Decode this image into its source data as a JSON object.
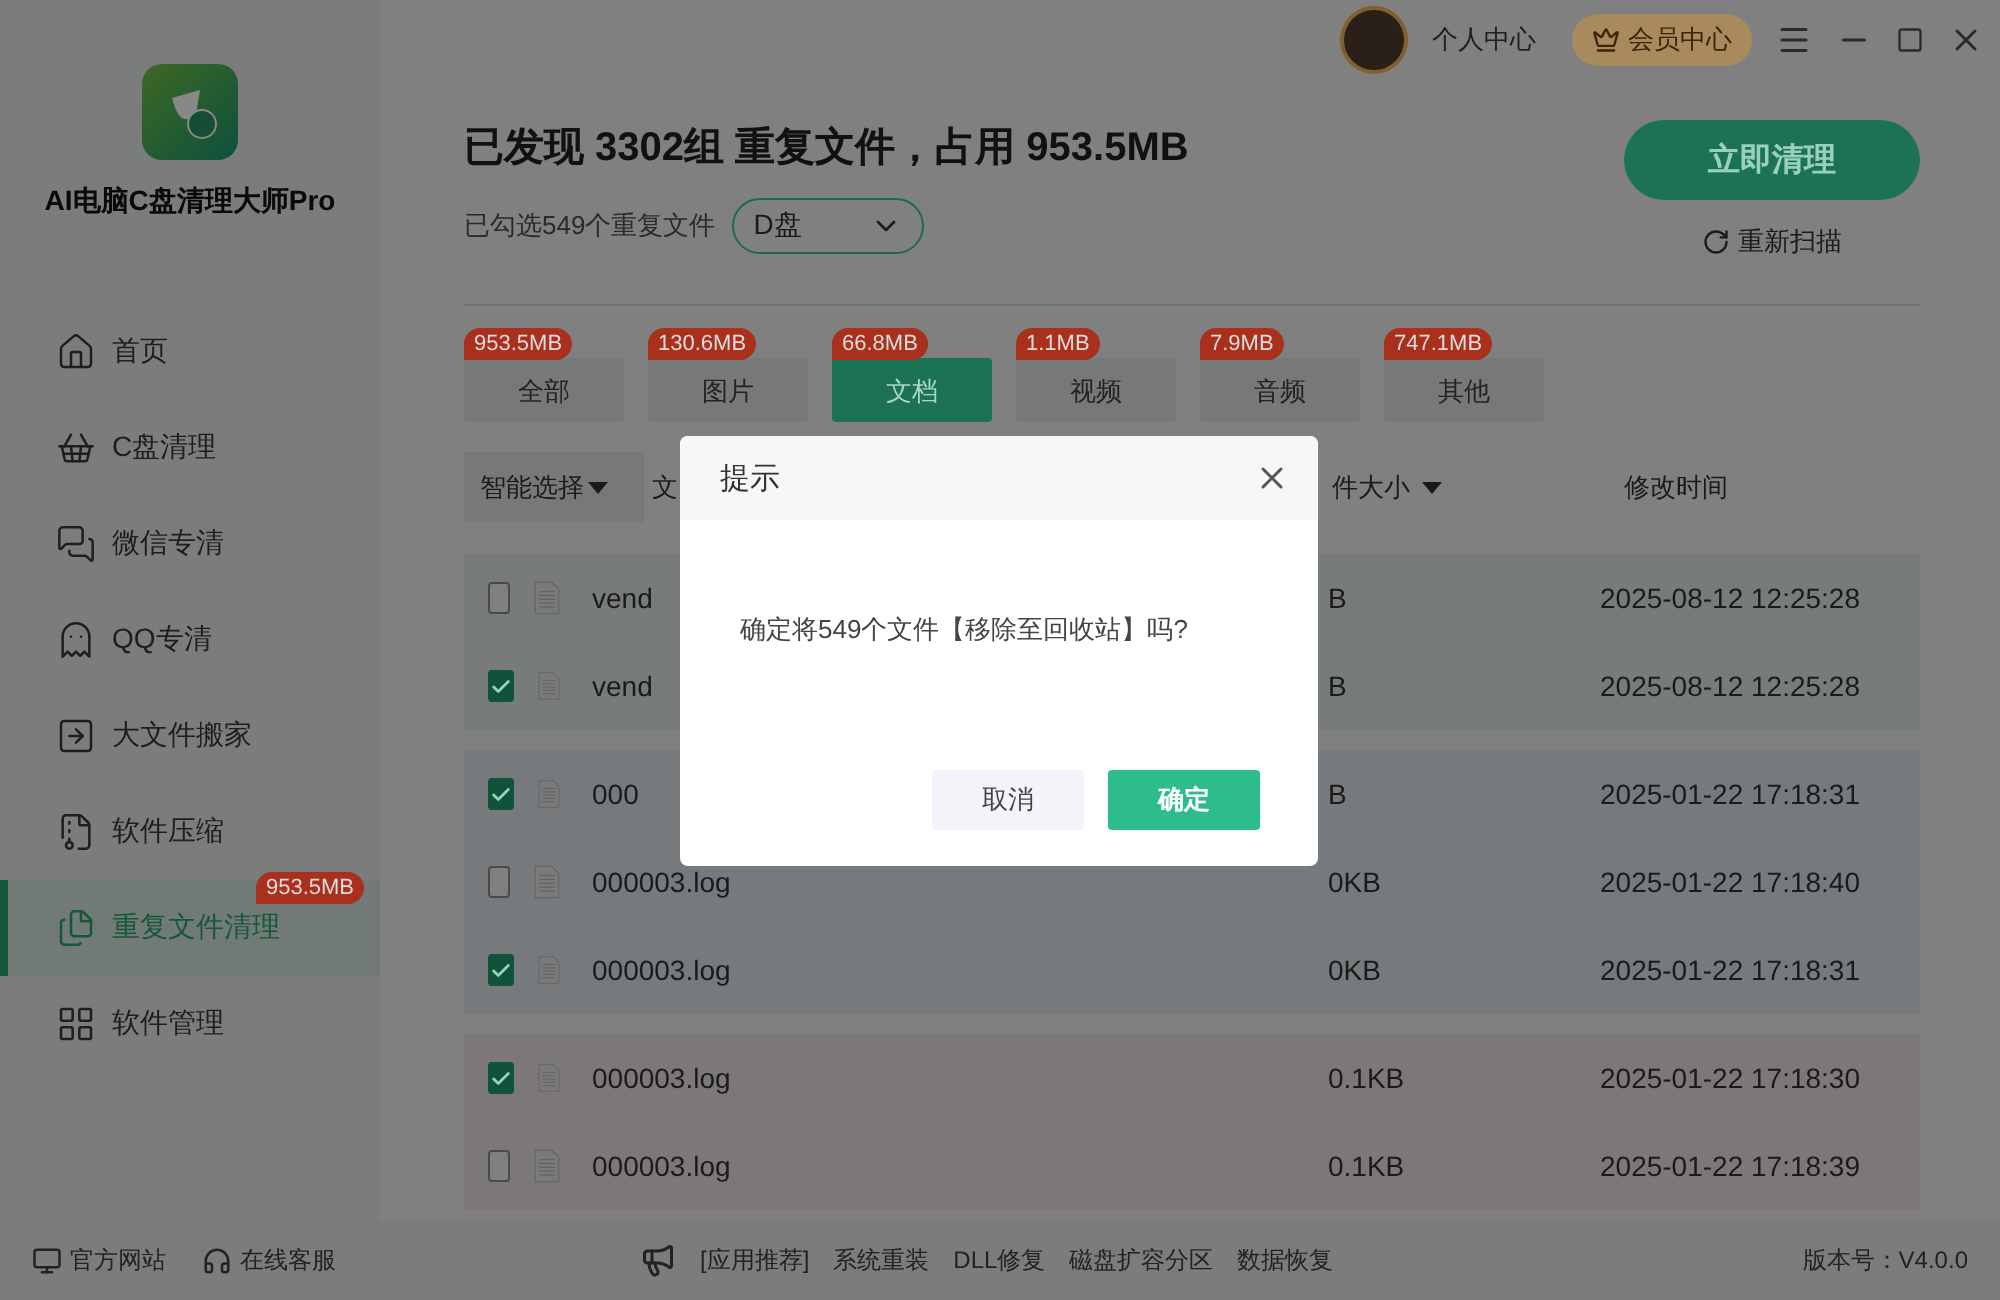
{
  "app": {
    "name": "AI电脑C盘清理大师Pro"
  },
  "sidebar": {
    "items": [
      {
        "label": "首页",
        "selected": false
      },
      {
        "label": "C盘清理",
        "selected": false
      },
      {
        "label": "微信专清",
        "selected": false
      },
      {
        "label": "QQ专清",
        "selected": false
      },
      {
        "label": "大文件搬家",
        "selected": false
      },
      {
        "label": "软件压缩",
        "selected": false
      },
      {
        "label": "重复文件清理",
        "selected": true,
        "badge": "953.5MB"
      },
      {
        "label": "软件管理",
        "selected": false
      }
    ]
  },
  "sidebar_footer": [
    "官方网站",
    "在线客服"
  ],
  "top_bar": {
    "profile": "个人中心",
    "member": "会员中心"
  },
  "summary": {
    "title": "已发现 3302组 重复文件，占用 953.5MB",
    "selected_info": "已勾选549个重复文件",
    "drive": "D盘",
    "clean_button": "立即清理",
    "rescan": "重新扫描"
  },
  "categories": [
    {
      "label": "全部",
      "size": "953.5MB",
      "selected": false
    },
    {
      "label": "图片",
      "size": "130.6MB",
      "selected": false
    },
    {
      "label": "文档",
      "size": "66.8MB",
      "selected": true
    },
    {
      "label": "视频",
      "size": "1.1MB",
      "selected": false
    },
    {
      "label": "音频",
      "size": "7.9MB",
      "selected": false
    },
    {
      "label": "其他",
      "size": "747.1MB",
      "selected": false
    }
  ],
  "table": {
    "columns": [
      {
        "label": "智能选择",
        "kind": "select"
      },
      {
        "label": "文",
        "kind": "name"
      },
      {
        "label": "件大小",
        "kind": "size"
      },
      {
        "label": "修改时间",
        "kind": "time"
      }
    ],
    "groups": [
      {
        "color": "#777c79",
        "rows": [
          {
            "checked": false,
            "name": "vend",
            "size": "B",
            "modified": "2025-08-12 12:25:28"
          },
          {
            "checked": true,
            "name": "vend",
            "size": "B",
            "modified": "2025-08-12 12:25:28"
          }
        ]
      },
      {
        "color": "#777a7c",
        "rows": [
          {
            "checked": true,
            "name": "000",
            "size": "B",
            "modified": "2025-01-22 17:18:31"
          },
          {
            "checked": false,
            "name": "000003.log",
            "size": "0KB",
            "modified": "2025-01-22 17:18:40"
          },
          {
            "checked": true,
            "name": "000003.log",
            "size": "0KB",
            "modified": "2025-01-22 17:18:31"
          }
        ]
      },
      {
        "color": "#7c787a",
        "rows": [
          {
            "checked": true,
            "name": "000003.log",
            "size": "0.1KB",
            "modified": "2025-01-22 17:18:30"
          },
          {
            "checked": false,
            "name": "000003.log",
            "size": "0.1KB",
            "modified": "2025-01-22 17:18:39"
          }
        ]
      }
    ]
  },
  "footer": {
    "links": [
      "[应用推荐]",
      "系统重装",
      "DLL修复",
      "磁盘扩容分区",
      "数据恢复"
    ],
    "version": "版本号：V4.0.0"
  },
  "dialog": {
    "title": "提示",
    "message": "确定将549个文件【移除至回收站】吗?",
    "buttons": [
      {
        "label": "取消",
        "kind": "secondary"
      },
      {
        "label": "确定",
        "kind": "primary"
      }
    ]
  }
}
